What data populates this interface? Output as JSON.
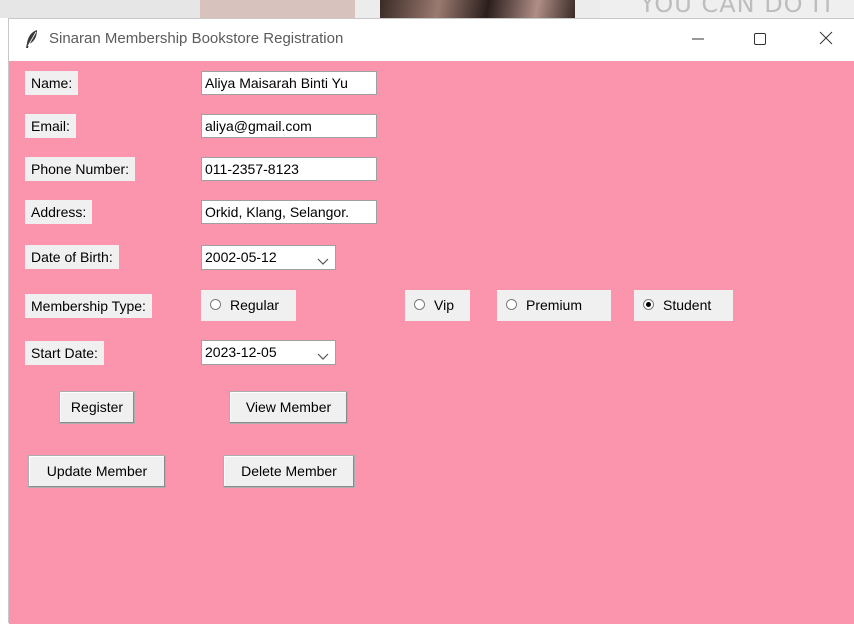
{
  "window": {
    "title": "Sinaran Membership Bookstore Registration",
    "client_bg": "#fb95ad"
  },
  "background_window": {
    "text": "YOU CAN DO IT"
  },
  "form": {
    "name": {
      "label": "Name:",
      "value": "Aliya Maisarah Binti Yu"
    },
    "email": {
      "label": "Email:",
      "value": "aliya@gmail.com"
    },
    "phone": {
      "label": "Phone Number:",
      "value": "011-2357-8123"
    },
    "address": {
      "label": "Address:",
      "value": "Orkid, Klang, Selangor."
    },
    "dob": {
      "label": "Date of Birth:",
      "value": "2002-05-12"
    },
    "membership": {
      "label": "Membership Type:",
      "options": [
        {
          "label": "Regular",
          "selected": false
        },
        {
          "label": "Vip",
          "selected": false
        },
        {
          "label": "Premium",
          "selected": false
        },
        {
          "label": "Student",
          "selected": true
        }
      ]
    },
    "start_date": {
      "label": "Start Date:",
      "value": "2023-12-05"
    }
  },
  "buttons": {
    "register": "Register",
    "view_member": "View Member",
    "update_member": "Update Member",
    "delete_member": "Delete Member"
  },
  "icons": {
    "app": "feather-icon",
    "minimize": "minimize-icon",
    "maximize": "maximize-icon",
    "close": "close-icon"
  }
}
